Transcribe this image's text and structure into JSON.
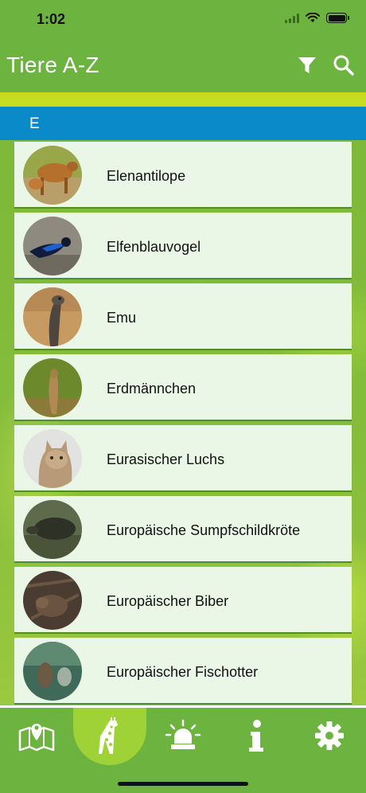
{
  "status_bar": {
    "time": "1:02"
  },
  "header": {
    "title": "Tiere A-Z"
  },
  "section": {
    "letter": "E"
  },
  "animals": [
    {
      "name": "Elenantilope",
      "icon": "elenantilope-photo"
    },
    {
      "name": "Elfenblauvogel",
      "icon": "elfenblauvogel-photo"
    },
    {
      "name": "Emu",
      "icon": "emu-photo"
    },
    {
      "name": "Erdmännchen",
      "icon": "erdmaennchen-photo"
    },
    {
      "name": "Eurasischer Luchs",
      "icon": "luchs-photo"
    },
    {
      "name": "Europäische Sumpfschildkröte",
      "icon": "sumpfschildkroete-photo"
    },
    {
      "name": "Europäischer Biber",
      "icon": "biber-photo"
    },
    {
      "name": "Europäischer Fischotter",
      "icon": "fischotter-photo"
    }
  ],
  "tabs": [
    {
      "icon": "map-pin-icon",
      "active": false
    },
    {
      "icon": "giraffe-icon",
      "active": true
    },
    {
      "icon": "alarm-icon",
      "active": false
    },
    {
      "icon": "info-icon",
      "active": false
    },
    {
      "icon": "gear-icon",
      "active": false
    }
  ],
  "colors": {
    "header_green": "#6cb33f",
    "section_blue": "#0a8ac9",
    "row_background": "#eaf7e6",
    "accent_yellow": "#c2d61c"
  }
}
